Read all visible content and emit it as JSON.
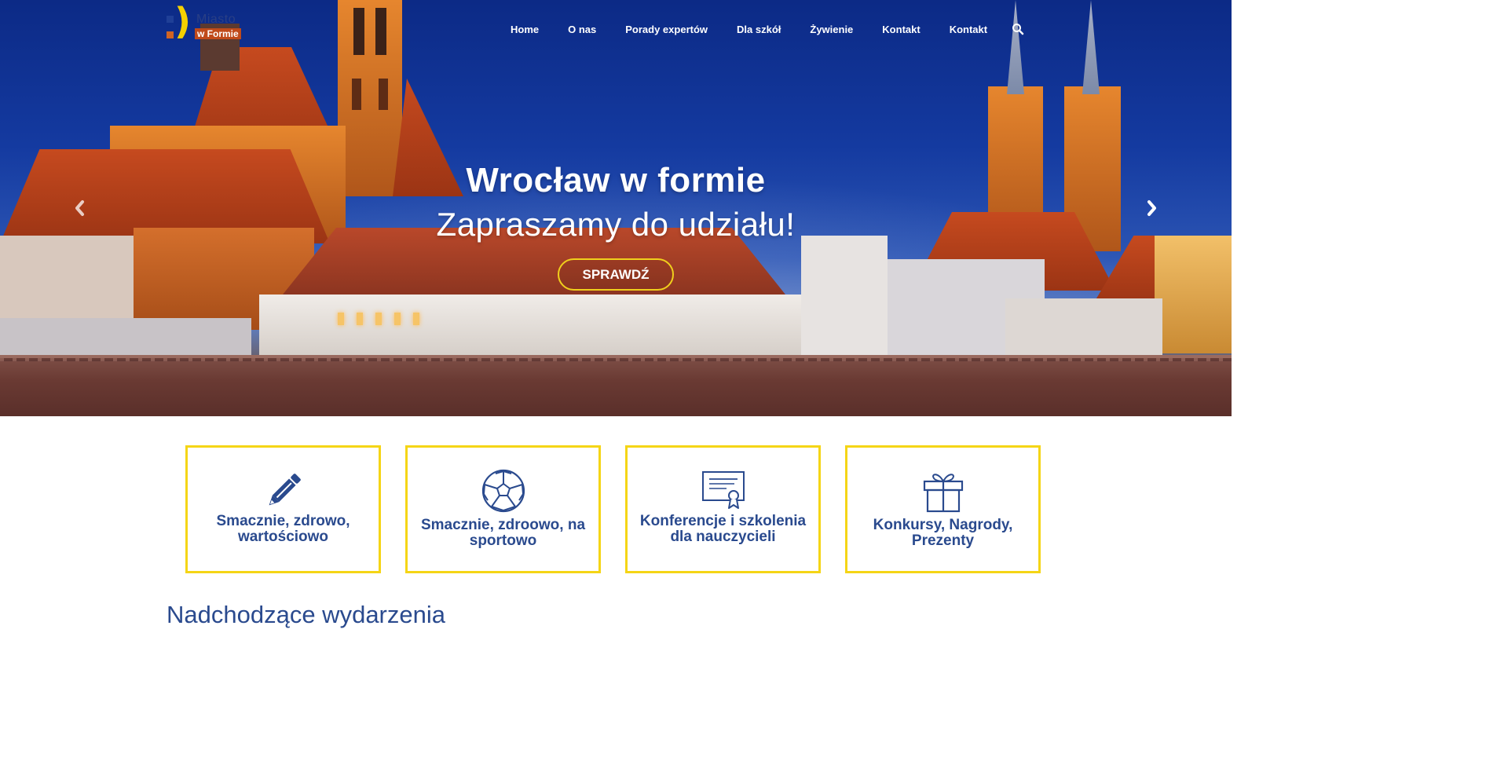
{
  "logo": {
    "line1": "Miasto",
    "line2": "w Formie"
  },
  "nav": {
    "items": [
      "Home",
      "O nas",
      "Porady expertów",
      "Dla szkół",
      "Żywienie",
      "Kontakt",
      "Kontakt"
    ],
    "search_icon": "search-icon"
  },
  "hero": {
    "title": "Wrocław w formie",
    "subtitle": "Zapraszamy do udziału!",
    "cta": "SPRAWDŹ",
    "prev_icon": "chevron-left-icon",
    "next_icon": "chevron-right-icon"
  },
  "cards": [
    {
      "icon": "pencil-icon",
      "label": "Smacznie, zdrowo, wartościowo"
    },
    {
      "icon": "soccer-ball-icon",
      "label": "Smacznie, zdroowo, na sportowo"
    },
    {
      "icon": "certificate-icon",
      "label": "Konferencje i szkolenia dla nauczycieli"
    },
    {
      "icon": "gift-icon",
      "label": "Konkursy, Nagrody, Prezenty"
    }
  ],
  "section": {
    "title": "Nadchodzące wydarzenia"
  },
  "colors": {
    "accent_yellow": "#f5d516",
    "text_blue": "#2a4a8e",
    "sky_blue": "#143aa0"
  }
}
